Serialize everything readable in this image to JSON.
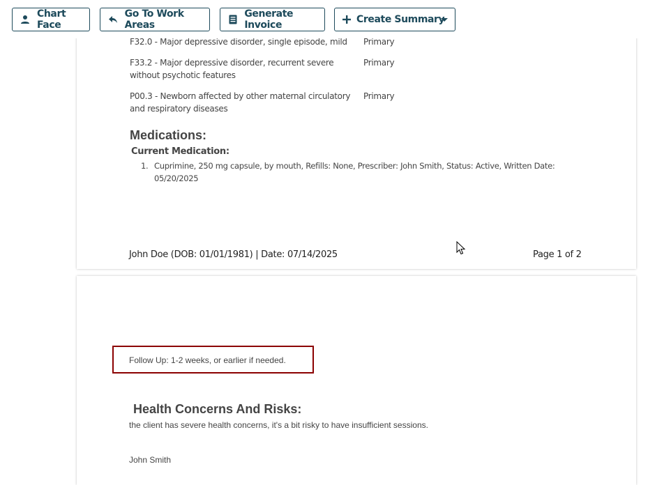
{
  "toolbar": {
    "chart_face": "Chart Face",
    "go_to_work_areas": "Go To Work Areas",
    "generate_invoice": "Generate Invoice",
    "create_summary": "Create Summary"
  },
  "diagnoses": [
    {
      "code_desc": "F32.0 - Major depressive disorder, single episode, mild",
      "type": "Primary"
    },
    {
      "code_desc_line1": "F33.2 - Major depressive disorder, recurrent severe",
      "code_desc_line2": "without psychotic features",
      "type": "Primary"
    },
    {
      "code_desc_line1": "P00.3 - Newborn affected by other maternal circulatory",
      "code_desc_line2": "and respiratory diseases",
      "type": "Primary"
    }
  ],
  "medications": {
    "title": "Medications:",
    "current_label": "Current Medication:",
    "items": [
      {
        "number": "1.",
        "line1": "Cuprimine, 250 mg capsule, by mouth, Refills: None,  Prescriber: John Smith, Status: Active, Written Date:",
        "line2": "05/20/2025"
      }
    ]
  },
  "page_footer": {
    "patient": "John Doe (DOB: 01/01/1981) | Date: 07/14/2025",
    "page": "Page 1 of 2"
  },
  "page2": {
    "follow_up": "Follow Up: 1-2 weeks, or earlier if needed.",
    "health_title": "Health Concerns And Risks:",
    "health_text": "the client has severe health concerns, it's a bit risky to have insufficient sessions.",
    "signature": "John Smith"
  },
  "colors": {
    "primary": "#1d4a5b",
    "highlight_border": "#8b0000"
  },
  "icons": [
    "person-icon",
    "reply-arrow-icon",
    "invoice-icon",
    "plus-icon",
    "caret-down-icon",
    "mouse-cursor-icon"
  ]
}
